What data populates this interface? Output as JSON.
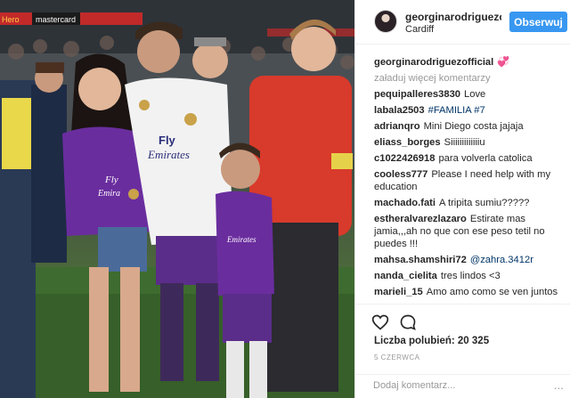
{
  "post": {
    "owner": "georginarodriguezofficial",
    "owner_truncated": "georginarodriguezo",
    "location": "Cardiff",
    "follow_label": "Obserwuj",
    "caption_user": "georginarodriguezofficial",
    "caption_emoji": "💞",
    "load_more": "załaduj więcej komentarzy",
    "likes": "Liczba polubień: 20 325",
    "date": "5 CZERWCA",
    "add_comment_placeholder": "Dodaj komentarz...",
    "more_icon": "..."
  },
  "photo_text": {
    "banner_sponsor": "mastercard",
    "banner_left": "Hero"
  },
  "comments": [
    {
      "user": "pequipalleres3830",
      "text": "Love"
    },
    {
      "user": "labala2503",
      "text": "#FAMILIA #7"
    },
    {
      "user": "adrianqro",
      "text": "Mini Diego costa jajaja"
    },
    {
      "user": "eliass_borges",
      "text": "Siiiiiiiiiiiiiu"
    },
    {
      "user": "c1022426918",
      "text": "para volverla catolica"
    },
    {
      "user": "cooless777",
      "text": "Please I need help with my education"
    },
    {
      "user": "machado.fati",
      "text": "A tripita sumiu?????"
    },
    {
      "user": "estheralvarezlazaro",
      "text": "Estirate mas jamia,,,ah no que con ese peso tetil no puedes !!!"
    },
    {
      "user": "mahsa.shamshiri72",
      "text": "@zahra.3412r"
    },
    {
      "user": "nanda_cielita",
      "text": "tres lindos <3"
    },
    {
      "user": "marieli_15",
      "text": "Amo amo como se ven juntos"
    }
  ],
  "colors": {
    "follow_bg": "#3897f0",
    "link": "#003569",
    "meta_gray": "#999999",
    "kit_white": "#f2f2f2",
    "kit_purple": "#6a2d9e"
  },
  "icons": [
    "heart-icon",
    "comment-icon",
    "more-options-icon"
  ]
}
